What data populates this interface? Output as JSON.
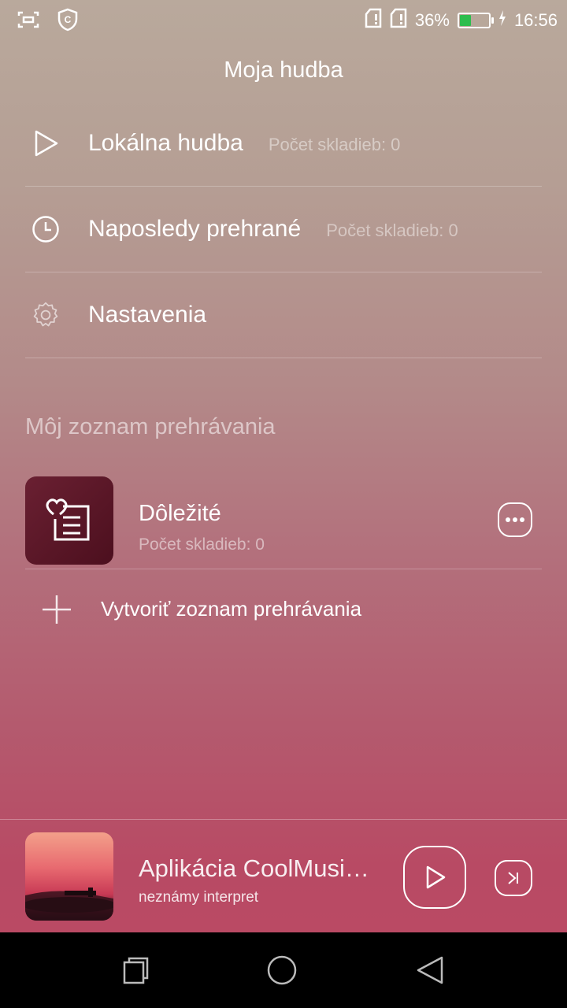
{
  "status_bar": {
    "battery_percent": "36%",
    "battery_level": 0.36,
    "time": "16:56",
    "icons": [
      "screenshot-icon",
      "shield-icon",
      "sim-card-icon",
      "sim-card-icon",
      "battery-icon",
      "charging-icon"
    ]
  },
  "header": {
    "title": "Moja hudba"
  },
  "menu": {
    "items": [
      {
        "label": "Lokálna hudba",
        "count": "Počet skladieb: 0",
        "icon": "play-icon"
      },
      {
        "label": "Naposledy prehrané",
        "count": "Počet skladieb: 0",
        "icon": "clock-icon"
      },
      {
        "label": "Nastavenia",
        "icon": "gear-icon"
      }
    ]
  },
  "playlists": {
    "section_title": "Môj zoznam prehrávania",
    "items": [
      {
        "name": "Dôležité",
        "count": "Počet skladieb: 0",
        "icon": "heart-list-icon"
      }
    ],
    "create_label": "Vytvoriť zoznam prehrávania"
  },
  "now_playing": {
    "title": "Aplikácia CoolMusi…",
    "artist": "neznámy interpret"
  },
  "nav": {
    "buttons": [
      "recents-icon",
      "home-icon",
      "back-icon"
    ]
  },
  "colors": {
    "battery_fill": "#2dbd4e",
    "cover_dark": "#4c0f1e",
    "navbar": "#000000"
  }
}
